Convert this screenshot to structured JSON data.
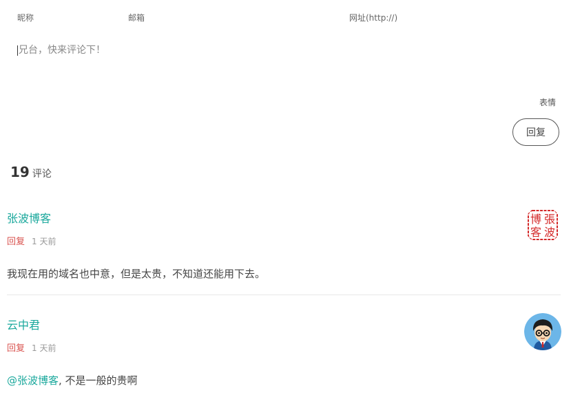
{
  "form": {
    "name_label": "昵称",
    "email_label": "邮箱",
    "url_label": "网址(http://)",
    "textarea_placeholder": "兄台，快来评论下！",
    "emoji_label": "表情",
    "reply_button": "回复"
  },
  "comments_header": {
    "count": "19",
    "label": "评论"
  },
  "comments": [
    {
      "author": "张波博客",
      "reply_label": "回复",
      "time": "1 天前",
      "text": "我现在用的域名也中意，但是太贵，不知道还能用下去。",
      "avatar_seal_text": "張波博客"
    },
    {
      "author": "云中君",
      "reply_label": "回复",
      "time": "1 天前",
      "mention": "@张波博客",
      "text": ", 不是一般的贵啊"
    }
  ]
}
